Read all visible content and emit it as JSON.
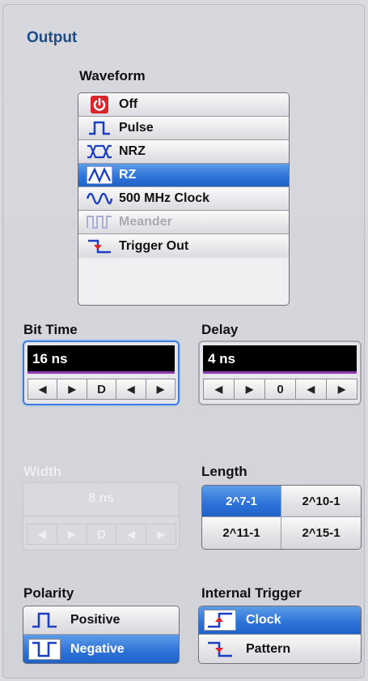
{
  "section_title": "Output",
  "waveform": {
    "label": "Waveform",
    "items": [
      {
        "label": "Off",
        "icon": "power-icon",
        "state": "normal"
      },
      {
        "label": "Pulse",
        "icon": "pulse-icon",
        "state": "normal"
      },
      {
        "label": "NRZ",
        "icon": "nrz-icon",
        "state": "normal"
      },
      {
        "label": "RZ",
        "icon": "rz-icon",
        "state": "selected"
      },
      {
        "label": "500 MHz Clock",
        "icon": "sine-icon",
        "state": "normal"
      },
      {
        "label": "Meander",
        "icon": "meander-icon",
        "state": "disabled"
      },
      {
        "label": "Trigger Out",
        "icon": "trigger-out-icon",
        "state": "normal"
      }
    ]
  },
  "bit_time": {
    "label": "Bit Time",
    "value": "16 ns",
    "arrows": [
      "◀",
      "▶",
      "D",
      "◀",
      "▶"
    ]
  },
  "delay": {
    "label": "Delay",
    "value": "4 ns",
    "arrows": [
      "◀",
      "▶",
      "0",
      "◀",
      "▶"
    ]
  },
  "width": {
    "label": "Width",
    "value": "8 ns",
    "arrows": [
      "◀",
      "▶",
      "D",
      "◀",
      "▶"
    ],
    "state": "disabled"
  },
  "length": {
    "label": "Length",
    "options": [
      "2^7-1",
      "2^10-1",
      "2^11-1",
      "2^15-1"
    ],
    "selected": "2^7-1"
  },
  "polarity": {
    "label": "Polarity",
    "options": [
      {
        "label": "Positive",
        "icon": "positive-pulse-icon"
      },
      {
        "label": "Negative",
        "icon": "negative-pulse-icon"
      }
    ],
    "selected": "Negative"
  },
  "internal_trigger": {
    "label": "Internal Trigger",
    "options": [
      {
        "label": "Clock",
        "icon": "rising-edge-icon"
      },
      {
        "label": "Pattern",
        "icon": "falling-edge-icon"
      }
    ],
    "selected": "Clock"
  },
  "colors": {
    "accent": "#2c72d8",
    "title": "#1e4c86",
    "value_bar": "#8e3ab3",
    "power_red": "#d9252a"
  }
}
